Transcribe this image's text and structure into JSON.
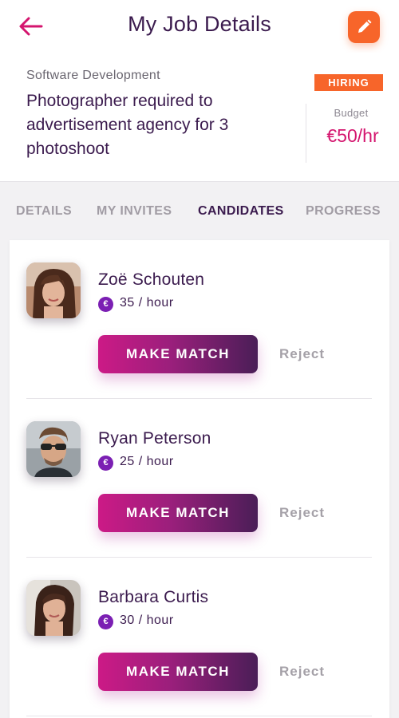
{
  "header": {
    "title": "My Job Details",
    "back_icon": "back-arrow-icon",
    "edit_icon": "pencil-icon"
  },
  "job": {
    "category": "Software Development",
    "title": "Photographer required to advertisement agency for 3 photoshoot",
    "status": "HIRING",
    "budget_label": "Budget",
    "budget_value": "€50/hr"
  },
  "tabs": [
    {
      "label": "DETAILS",
      "active": false
    },
    {
      "label": "MY INVITES",
      "active": false
    },
    {
      "label": "CANDIDATES",
      "active": true
    },
    {
      "label": "PROGRESS",
      "active": false
    }
  ],
  "candidates": [
    {
      "name": "Zoë Schouten",
      "rate": "35 / hour",
      "match_label": "MAKE MATCH",
      "reject_label": "Reject"
    },
    {
      "name": "Ryan Peterson",
      "rate": "25 / hour",
      "match_label": "MAKE MATCH",
      "reject_label": "Reject"
    },
    {
      "name": "Barbara Curtis",
      "rate": "30 / hour",
      "match_label": "MAKE MATCH",
      "reject_label": "Reject"
    }
  ],
  "currency_symbol": "€",
  "colors": {
    "accent_orange": "#f7652a",
    "accent_pink": "#d4156e",
    "primary_dark": "#3b1b4e",
    "rate_icon": "#7b1fb3"
  }
}
